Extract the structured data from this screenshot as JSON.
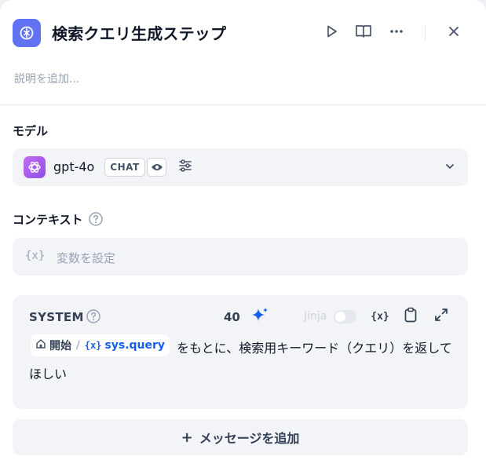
{
  "header": {
    "title": "検索クエリ生成ステップ",
    "description_placeholder": "説明を追加..."
  },
  "model": {
    "label": "モデル",
    "name": "gpt-4o",
    "mode_badge": "CHAT",
    "icon": "openai-icon"
  },
  "context": {
    "label": "コンテキスト",
    "placeholder": "変数を設定",
    "var_icon": "{x}"
  },
  "prompt": {
    "role": "SYSTEM",
    "token_count": "40",
    "jinja_label": "Jinja",
    "jinja_enabled": false,
    "var_icon": "{x}",
    "variable": {
      "node": "開始",
      "separator": "/",
      "name": "sys.query"
    },
    "text_line1": "をもとに、検索用キーワード（クエリ）を返して",
    "text_line2": "ほしい"
  },
  "add_message": {
    "plus": "+",
    "label": "メッセージを追加"
  },
  "colors": {
    "accent": "#155eef",
    "node_icon_bg": "#6172f3",
    "model_icon_bg": "#9b59ec",
    "panel_bg": "#ffffff",
    "field_bg": "#f2f4f7"
  }
}
